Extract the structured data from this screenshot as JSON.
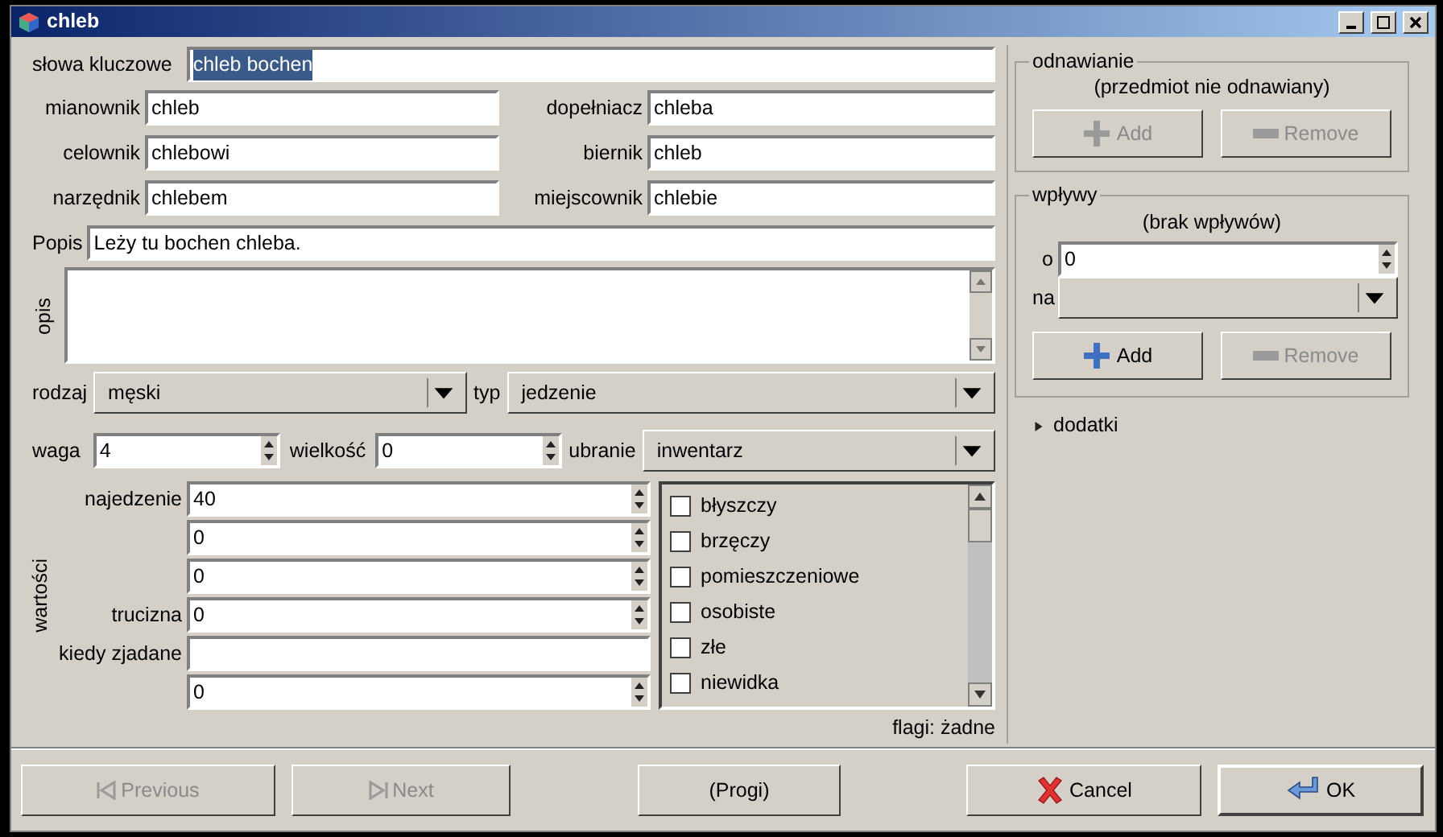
{
  "window": {
    "title": "chleb"
  },
  "keywords": {
    "label": "słowa kluczowe",
    "value": "chleb bochen",
    "selected": true
  },
  "cases": [
    {
      "label": "mianownik",
      "value": "chleb"
    },
    {
      "label": "dopełniacz",
      "value": "chleba"
    },
    {
      "label": "celownik",
      "value": "chlebowi"
    },
    {
      "label": "biernik",
      "value": "chleb"
    },
    {
      "label": "narzędnik",
      "value": "chlebem"
    },
    {
      "label": "miejscownik",
      "value": "chlebie"
    }
  ],
  "popis": {
    "label": "Popis",
    "value": "Leży tu bochen chleba."
  },
  "opis": {
    "label": "opis"
  },
  "rodzaj": {
    "label": "rodzaj",
    "value": "męski"
  },
  "typ": {
    "label": "typ",
    "value": "jedzenie"
  },
  "waga": {
    "label": "waga",
    "value": "4"
  },
  "wielkosc": {
    "label": "wielkość",
    "value": "0"
  },
  "ubranie": {
    "label": "ubranie",
    "value": "inwentarz"
  },
  "wartosci": {
    "label": "wartości",
    "rows": [
      {
        "label": "najedzenie",
        "value": "40",
        "kind": "spin"
      },
      {
        "value": "0",
        "kind": "spin"
      },
      {
        "value": "0",
        "kind": "spin"
      },
      {
        "label": "trucizna",
        "value": "0",
        "kind": "spin"
      },
      {
        "label": "kiedy zjadane",
        "kind": "text"
      },
      {
        "value": "0",
        "kind": "spin"
      }
    ]
  },
  "flags": {
    "items": [
      {
        "label": "błyszczy",
        "checked": false
      },
      {
        "label": "brzęczy",
        "checked": false
      },
      {
        "label": "pomieszczeniowe",
        "checked": false
      },
      {
        "label": "osobiste",
        "checked": false
      },
      {
        "label": "złe",
        "checked": false
      },
      {
        "label": "niewidka",
        "checked": false
      }
    ],
    "summary": "flagi: żadne"
  },
  "odnawianie": {
    "title": "odnawianie",
    "status": "(przedmiot nie odnawiany)",
    "buttons": [
      {
        "label": "Add",
        "kind": "add",
        "disabled": true
      },
      {
        "label": "Remove",
        "kind": "remove",
        "disabled": true
      }
    ]
  },
  "wplywy": {
    "title": "wpływy",
    "status": "(brak wpływów)",
    "o": {
      "label": "o",
      "value": "0"
    },
    "na": {
      "label": "na"
    },
    "buttons": [
      {
        "label": "Add",
        "kind": "add",
        "disabled": false
      },
      {
        "label": "Remove",
        "kind": "remove",
        "disabled": true
      }
    ]
  },
  "dodatki": {
    "label": "dodatki",
    "expanded": false
  },
  "footer": [
    {
      "label": "Previous",
      "kind": "previous",
      "disabled": true
    },
    {
      "label": "Next",
      "kind": "next",
      "disabled": true
    },
    {
      "label": "(Progi)",
      "kind": "plain",
      "disabled": false
    },
    {
      "label": "Cancel",
      "kind": "cancel",
      "disabled": false
    },
    {
      "label": "OK",
      "kind": "ok",
      "disabled": false
    }
  ]
}
